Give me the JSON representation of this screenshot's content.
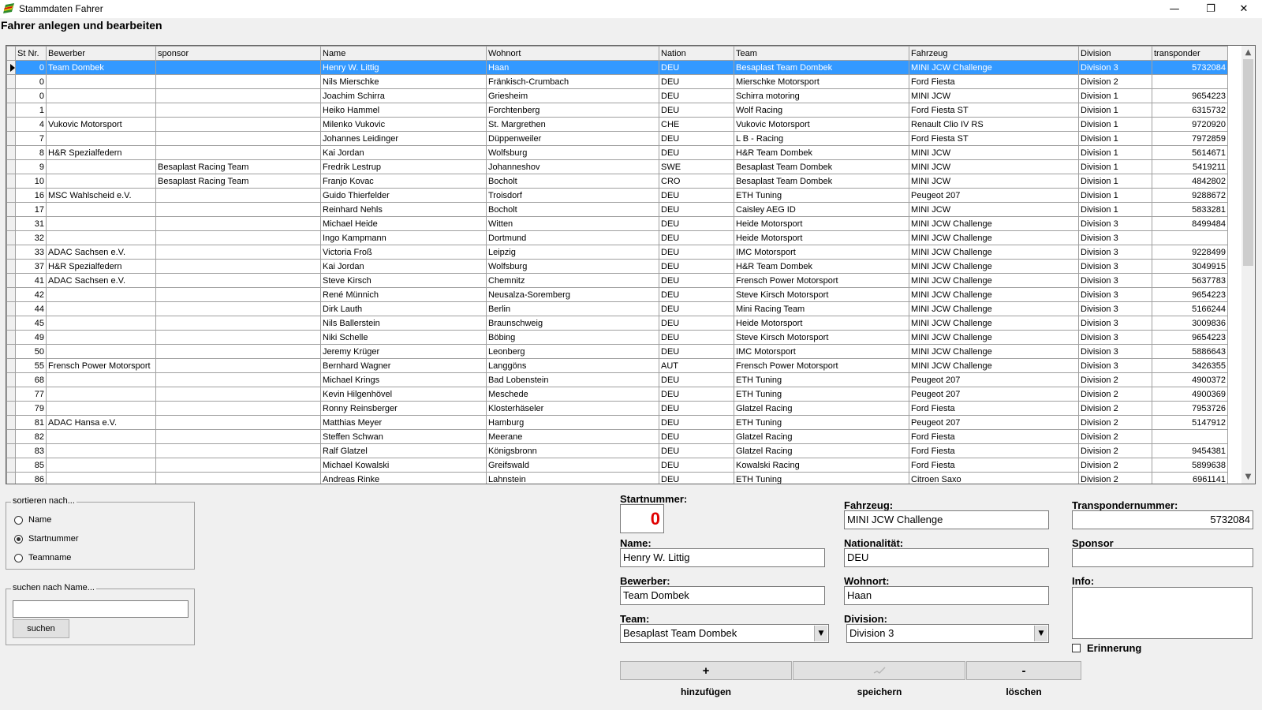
{
  "window": {
    "title": "Stammdaten Fahrer",
    "minimize_glyph": "—",
    "maximize_glyph": "❐",
    "close_glyph": "✕"
  },
  "heading": "Fahrer anlegen und bearbeiten",
  "grid": {
    "columns": [
      "St Nr.",
      "Bewerber",
      "sponsor",
      "Name",
      "Wohnort",
      "Nation",
      "Team",
      "Fahrzeug",
      "Division",
      "transponder"
    ],
    "selected_row": 0,
    "rows": [
      [
        "0",
        "Team Dombek",
        "",
        "Henry W. Littig",
        "Haan",
        "DEU",
        "Besaplast Team Dombek",
        "MINI JCW Challenge",
        "Division 3",
        "5732084"
      ],
      [
        "0",
        "",
        "",
        "Nils Mierschke",
        "Fränkisch-Crumbach",
        "DEU",
        "Mierschke Motorsport",
        "Ford Fiesta",
        "Division 2",
        ""
      ],
      [
        "0",
        "",
        "",
        "Joachim Schirra",
        "Griesheim",
        "DEU",
        "Schirra motoring",
        "MINI JCW",
        "Division 1",
        "9654223"
      ],
      [
        "1",
        "",
        "",
        "Heiko Hammel",
        "Forchtenberg",
        "DEU",
        "Wolf Racing",
        "Ford Fiesta ST",
        "Division 1",
        "6315732"
      ],
      [
        "4",
        "Vukovic Motorsport",
        "",
        "Milenko Vukovic",
        "St. Margrethen",
        "CHE",
        "Vukovic Motorsport",
        "Renault Clio IV RS",
        "Division 1",
        "9720920"
      ],
      [
        "7",
        "",
        "",
        "Johannes Leidinger",
        "Düppenweiler",
        "DEU",
        "L B - Racing",
        "Ford Fiesta ST",
        "Division 1",
        "7972859"
      ],
      [
        "8",
        "H&R Spezialfedern",
        "",
        "Kai Jordan",
        "Wolfsburg",
        "DEU",
        "H&R Team Dombek",
        "MINI JCW",
        "Division 1",
        "5614671"
      ],
      [
        "9",
        "",
        "Besaplast Racing Team",
        "Fredrik Lestrup",
        "Johanneshov",
        "SWE",
        "Besaplast Team Dombek",
        "MINI JCW",
        "Division 1",
        "5419211"
      ],
      [
        "10",
        "",
        "Besaplast Racing Team",
        "Franjo Kovac",
        "Bocholt",
        "CRO",
        "Besaplast Team Dombek",
        "MINI JCW",
        "Division 1",
        "4842802"
      ],
      [
        "16",
        "MSC Wahlscheid e.V.",
        "",
        "Guido Thierfelder",
        "Troisdorf",
        "DEU",
        "ETH Tuning",
        "Peugeot 207",
        "Division 1",
        "9288672"
      ],
      [
        "17",
        "",
        "",
        "Reinhard Nehls",
        "Bocholt",
        "DEU",
        "Caisley AEG ID",
        "MINI JCW",
        "Division 1",
        "5833281"
      ],
      [
        "31",
        "",
        "",
        "Michael Heide",
        "Witten",
        "DEU",
        "Heide Motorsport",
        "MINI JCW Challenge",
        "Division 3",
        "8499484"
      ],
      [
        "32",
        "",
        "",
        "Ingo Kampmann",
        "Dortmund",
        "DEU",
        "Heide Motorsport",
        "MINI JCW Challenge",
        "Division 3",
        ""
      ],
      [
        "33",
        "ADAC Sachsen e.V.",
        "",
        "Victoria Froß",
        "Leipzig",
        "DEU",
        "IMC Motorsport",
        "MINI JCW Challenge",
        "Division 3",
        "9228499"
      ],
      [
        "37",
        "H&R Spezialfedern",
        "",
        "Kai Jordan",
        "Wolfsburg",
        "DEU",
        "H&R Team Dombek",
        "MINI JCW Challenge",
        "Division 3",
        "3049915"
      ],
      [
        "41",
        "ADAC Sachsen e.V.",
        "",
        "Steve Kirsch",
        "Chemnitz",
        "DEU",
        "Frensch Power Motorsport",
        "MINI JCW Challenge",
        "Division 3",
        "5637783"
      ],
      [
        "42",
        "",
        "",
        "René Münnich",
        "Neusalza-Soremberg",
        "DEU",
        "Steve Kirsch Motorsport",
        "MINI JCW Challenge",
        "Division 3",
        "9654223"
      ],
      [
        "44",
        "",
        "",
        "Dirk Lauth",
        "Berlin",
        "DEU",
        "Mini Racing Team",
        "MINI JCW Challenge",
        "Division 3",
        "5166244"
      ],
      [
        "45",
        "",
        "",
        "Nils Ballerstein",
        "Braunschweig",
        "DEU",
        "Heide Motorsport",
        "MINI JCW Challenge",
        "Division 3",
        "3009836"
      ],
      [
        "49",
        "",
        "",
        "Niki Schelle",
        "Böbing",
        "DEU",
        "Steve Kirsch Motorsport",
        "MINI JCW Challenge",
        "Division 3",
        "9654223"
      ],
      [
        "50",
        "",
        "",
        "Jeremy Krüger",
        "Leonberg",
        "DEU",
        "IMC Motorsport",
        "MINI JCW Challenge",
        "Division 3",
        "5886643"
      ],
      [
        "55",
        "Frensch Power Motorsport",
        "",
        "Bernhard Wagner",
        "Langgöns",
        "AUT",
        "Frensch Power Motorsport",
        "MINI JCW Challenge",
        "Division 3",
        "3426355"
      ],
      [
        "68",
        "",
        "",
        "Michael Krings",
        "Bad Lobenstein",
        "DEU",
        "ETH Tuning",
        "Peugeot 207",
        "Division 2",
        "4900372"
      ],
      [
        "77",
        "",
        "",
        "Kevin Hilgenhövel",
        "Meschede",
        "DEU",
        "ETH Tuning",
        "Peugeot 207",
        "Division 2",
        "4900369"
      ],
      [
        "79",
        "",
        "",
        "Ronny Reinsberger",
        "Klosterhäseler",
        "DEU",
        "Glatzel Racing",
        "Ford Fiesta",
        "Division 2",
        "7953726"
      ],
      [
        "81",
        "ADAC Hansa e.V.",
        "",
        "Matthias Meyer",
        "Hamburg",
        "DEU",
        "ETH Tuning",
        "Peugeot 207",
        "Division 2",
        "5147912"
      ],
      [
        "82",
        "",
        "",
        "Steffen Schwan",
        "Meerane",
        "DEU",
        "Glatzel Racing",
        "Ford Fiesta",
        "Division 2",
        ""
      ],
      [
        "83",
        "",
        "",
        "Ralf Glatzel",
        "Königsbronn",
        "DEU",
        "Glatzel Racing",
        "Ford Fiesta",
        "Division 2",
        "9454381"
      ],
      [
        "85",
        "",
        "",
        "Michael Kowalski",
        "Greifswald",
        "DEU",
        "Kowalski Racing",
        "Ford Fiesta",
        "Division 2",
        "5899638"
      ],
      [
        "86",
        "",
        "",
        "Andreas Rinke",
        "Lahnstein",
        "DEU",
        "ETH Tuning",
        "Citroen Saxo",
        "Division 2",
        "6961141"
      ]
    ]
  },
  "sort": {
    "legend": "sortieren nach...",
    "options": [
      "Name",
      "Startnummer",
      "Teamname"
    ],
    "selected": "Startnummer"
  },
  "search": {
    "legend": "suchen nach Name...",
    "value": "",
    "button": "suchen"
  },
  "form": {
    "startnummer_label": "Startnummer:",
    "startnummer": "0",
    "name_label": "Name:",
    "name": "Henry W. Littig",
    "bewerber_label": "Bewerber:",
    "bewerber": "Team Dombek",
    "team_label": "Team:",
    "team": "Besaplast Team Dombek",
    "fahrzeug_label": "Fahrzeug:",
    "fahrzeug": "MINI JCW Challenge",
    "nationalitaet_label": "Nationalität:",
    "nationalitaet": "DEU",
    "wohnort_label": "Wohnort:",
    "wohnort": "Haan",
    "division_label": "Division:",
    "division": "Division 3",
    "transponder_label": "Transpondernummer:",
    "transponder": "5732084",
    "sponsor_label": "Sponsor",
    "sponsor": "",
    "info_label": "Info:",
    "erinnerung_label": "Erinnerung"
  },
  "actions": {
    "add_symbol": "+",
    "add_label": "hinzufügen",
    "save_label": "speichern",
    "delete_symbol": "-",
    "delete_label": "löschen"
  },
  "colors": {
    "selection": "#3399ff",
    "startnummer": "#e00000"
  }
}
